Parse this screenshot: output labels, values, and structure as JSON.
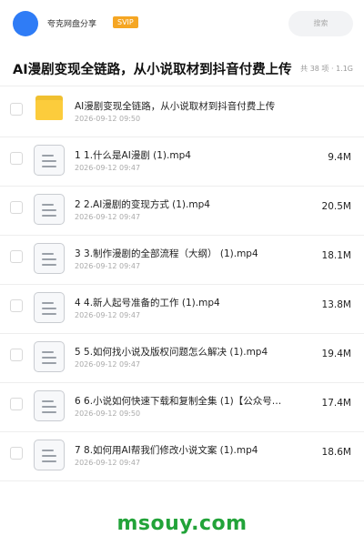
{
  "header": {
    "share_name": "夸克网盘分享",
    "vip_badge": "SVIP",
    "search_placeholder": "搜索"
  },
  "folder": {
    "title": "AI漫剧变现全链路，从小说取材到抖音付费上传",
    "meta": "共 38 项 · 1.1G"
  },
  "files": [
    {
      "name": "AI漫剧变现全链路，从小说取材到抖音付费上传",
      "date": "2026-09-12 09:50",
      "size": "",
      "type": "folder"
    },
    {
      "name": "1 1.什么是AI漫剧 (1).mp4",
      "date": "2026-09-12 09:47",
      "size": "9.4M",
      "type": "video"
    },
    {
      "name": "2 2.AI漫剧的变现方式 (1).mp4",
      "date": "2026-09-12 09:47",
      "size": "20.5M",
      "type": "video"
    },
    {
      "name": "3 3.制作漫剧的全部流程（大纲） (1).mp4",
      "date": "2026-09-12 09:47",
      "size": "18.1M",
      "type": "video"
    },
    {
      "name": "4 4.新人起号准备的工作 (1).mp4",
      "date": "2026-09-12 09:47",
      "size": "13.8M",
      "type": "video"
    },
    {
      "name": "5 5.如何找小说及版权问题怎么解决 (1).mp4",
      "date": "2026-09-12 09:47",
      "size": "19.4M",
      "type": "video"
    },
    {
      "name": "6 6.小说如何快速下载和复制全集 (1)【公众号…",
      "date": "2026-09-12 09:50",
      "size": "17.4M",
      "type": "video"
    },
    {
      "name": "7 8.如何用AI帮我们修改小说文案 (1).mp4",
      "date": "2026-09-12 09:47",
      "size": "18.6M",
      "type": "video"
    }
  ],
  "watermark": "msouy.com",
  "colors": {
    "avatar": "#2f7cf6",
    "vip": "#f5a623",
    "folder": "#fccc3c",
    "watermark": "#22a339"
  }
}
